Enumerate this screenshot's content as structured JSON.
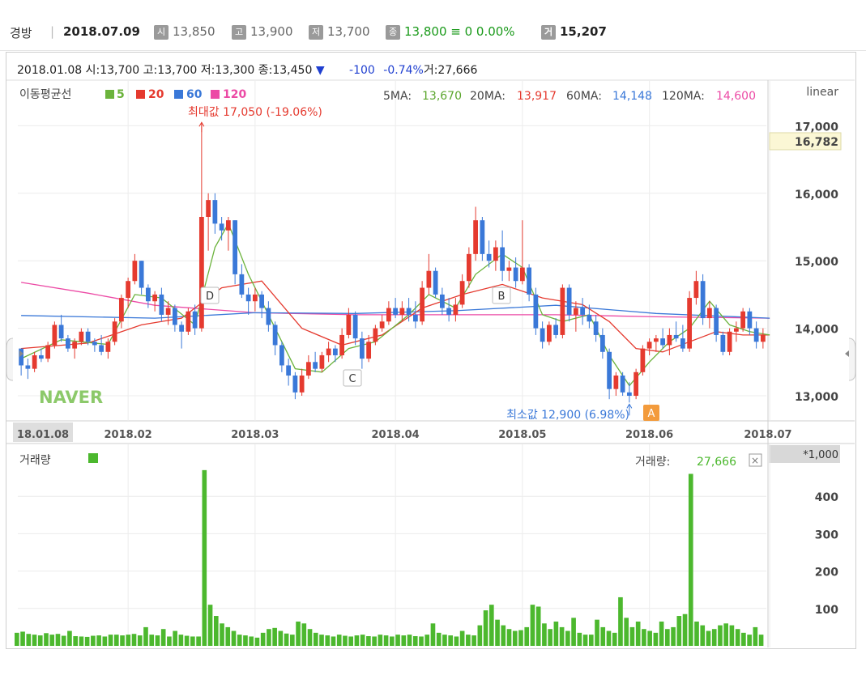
{
  "header": {
    "name": "경방",
    "separator": "|",
    "date": "2018.07.09",
    "open_icon": "시",
    "open": "13,850",
    "high_icon": "고",
    "high": "13,900",
    "low_icon": "저",
    "low": "13,700",
    "close_icon": "종",
    "close_change": "13,800 ≡ 0 0.00%",
    "volume_icon": "거",
    "volume": "15,207"
  },
  "info_bar": {
    "date": "2018.01.08",
    "open": "시:13,700",
    "high": "고:13,700",
    "low": "저:13,300",
    "close": "종:13,450",
    "down_icon": "▼",
    "change": "-100",
    "pct": "-0.74%",
    "volume": "거:27,666"
  },
  "ma_legend": {
    "title": "이동평균선",
    "items": [
      {
        "label": "5",
        "color": "#6bb33c"
      },
      {
        "label": "20",
        "color": "#e53a2f"
      },
      {
        "label": "60",
        "color": "#3a78d8"
      },
      {
        "label": "120",
        "color": "#ec4aa5"
      }
    ]
  },
  "ma_values": {
    "ma5_label": "5MA:",
    "ma5": "13,670",
    "ma20_label": "20MA:",
    "ma20": "13,917",
    "ma60_label": "60MA:",
    "ma60": "14,148",
    "ma120_label": "120MA:",
    "ma120": "14,600"
  },
  "scale_label": "linear",
  "current_price_tag": "16,782",
  "max_annotation": "최대값 17,050 (-19.06%)",
  "min_annotation": "최소값 12,900 (6.98%)",
  "watermark": "NAVER",
  "markers": [
    "A",
    "B",
    "C",
    "D"
  ],
  "volume_panel": {
    "label": "거래량",
    "value_label": "거래량:",
    "value": "27,666",
    "close_icon": "×",
    "unit": "*1,000"
  },
  "colors": {
    "up": "#e53a2f",
    "down": "#3a78d8",
    "volume": "#4cb82e",
    "ma5": "#6bb33c",
    "ma20": "#e53a2f",
    "ma60": "#3a78d8",
    "ma120": "#ec4aa5"
  },
  "chart_data": [
    {
      "type": "candlestick",
      "x_ticks": [
        "18.01.08",
        "2018.02",
        "2018.03",
        "2018.04",
        "2018.05",
        "2018.06",
        "2018.07"
      ],
      "y_ticks": [
        13000,
        14000,
        15000,
        16000,
        17000
      ],
      "ylim": [
        12650,
        17250
      ],
      "scale": "linear",
      "max": {
        "value": 17050,
        "label": "최대값 17,050 (-19.06%)"
      },
      "min": {
        "value": 12900,
        "label": "최소값 12,900 (6.98%)"
      },
      "candles": [
        [
          13700,
          13700,
          13300,
          13450
        ],
        [
          13450,
          13550,
          13250,
          13400
        ],
        [
          13400,
          13650,
          13350,
          13600
        ],
        [
          13600,
          13700,
          13500,
          13550
        ],
        [
          13550,
          13800,
          13500,
          13750
        ],
        [
          13750,
          14100,
          13700,
          14050
        ],
        [
          14050,
          14200,
          13800,
          13850
        ],
        [
          13850,
          13900,
          13650,
          13700
        ],
        [
          13700,
          13850,
          13550,
          13800
        ],
        [
          13800,
          14000,
          13750,
          13950
        ],
        [
          13950,
          14000,
          13750,
          13800
        ],
        [
          13800,
          13850,
          13650,
          13750
        ],
        [
          13750,
          13900,
          13600,
          13650
        ],
        [
          13650,
          13850,
          13550,
          13800
        ],
        [
          13800,
          14150,
          13750,
          14100
        ],
        [
          14100,
          14500,
          14000,
          14450
        ],
        [
          14450,
          14750,
          14300,
          14700
        ],
        [
          14700,
          15100,
          14650,
          15000
        ],
        [
          15000,
          15000,
          14500,
          14600
        ],
        [
          14600,
          14650,
          14300,
          14400
        ],
        [
          14400,
          14550,
          14250,
          14500
        ],
        [
          14500,
          14600,
          14100,
          14200
        ],
        [
          14200,
          14400,
          14050,
          14300
        ],
        [
          14300,
          14350,
          13950,
          14050
        ],
        [
          14050,
          14100,
          13700,
          13950
        ],
        [
          13950,
          14300,
          13900,
          14250
        ],
        [
          14250,
          14350,
          13900,
          14000
        ],
        [
          14000,
          17050,
          13950,
          15650
        ],
        [
          15650,
          16000,
          15150,
          15900
        ],
        [
          15900,
          16000,
          15400,
          15550
        ],
        [
          15550,
          15650,
          15300,
          15450
        ],
        [
          15450,
          15650,
          15150,
          15600
        ],
        [
          15600,
          15600,
          14650,
          14800
        ],
        [
          14800,
          14950,
          14450,
          14500
        ],
        [
          14500,
          14600,
          14200,
          14400
        ],
        [
          14400,
          14600,
          14250,
          14500
        ],
        [
          14500,
          14550,
          14150,
          14300
        ],
        [
          14300,
          14400,
          13950,
          14050
        ],
        [
          14050,
          14100,
          13600,
          13750
        ],
        [
          13750,
          13800,
          13350,
          13450
        ],
        [
          13450,
          13550,
          13150,
          13300
        ],
        [
          13300,
          13350,
          12950,
          13050
        ],
        [
          13050,
          13400,
          13000,
          13300
        ],
        [
          13300,
          13600,
          13250,
          13500
        ],
        [
          13500,
          13650,
          13350,
          13400
        ],
        [
          13400,
          13650,
          13350,
          13600
        ],
        [
          13600,
          13800,
          13500,
          13700
        ],
        [
          13700,
          13750,
          13500,
          13600
        ],
        [
          13600,
          14000,
          13550,
          13900
        ],
        [
          13900,
          14300,
          13850,
          14200
        ],
        [
          14200,
          14250,
          13750,
          13850
        ],
        [
          13850,
          13950,
          13400,
          13550
        ],
        [
          13550,
          13900,
          13500,
          13800
        ],
        [
          13800,
          14050,
          13750,
          14000
        ],
        [
          14000,
          14200,
          13950,
          14100
        ],
        [
          14100,
          14400,
          14050,
          14300
        ],
        [
          14300,
          14450,
          14150,
          14200
        ],
        [
          14200,
          14400,
          14100,
          14300
        ],
        [
          14300,
          14450,
          14100,
          14200
        ],
        [
          14200,
          14400,
          14000,
          14100
        ],
        [
          14100,
          14700,
          14050,
          14600
        ],
        [
          14600,
          15100,
          14500,
          14850
        ],
        [
          14850,
          14900,
          14450,
          14500
        ],
        [
          14500,
          14600,
          14200,
          14300
        ],
        [
          14300,
          14450,
          14100,
          14200
        ],
        [
          14200,
          14450,
          14100,
          14350
        ],
        [
          14350,
          14800,
          14300,
          14700
        ],
        [
          14700,
          15200,
          14600,
          15100
        ],
        [
          15100,
          15800,
          15000,
          15600
        ],
        [
          15600,
          15650,
          15000,
          15100
        ],
        [
          15100,
          15300,
          14900,
          15000
        ],
        [
          15000,
          15300,
          14850,
          15200
        ],
        [
          15200,
          15450,
          14700,
          14850
        ],
        [
          14850,
          15000,
          14700,
          14900
        ],
        [
          14900,
          15050,
          14600,
          14700
        ],
        [
          14700,
          15600,
          14650,
          14900
        ],
        [
          14900,
          14950,
          14400,
          14500
        ],
        [
          14500,
          14600,
          13900,
          14000
        ],
        [
          14000,
          14100,
          13700,
          13800
        ],
        [
          13800,
          14100,
          13750,
          14050
        ],
        [
          14050,
          14150,
          13850,
          13900
        ],
        [
          13900,
          14650,
          13850,
          14600
        ],
        [
          14600,
          14650,
          14100,
          14200
        ],
        [
          14200,
          14400,
          13950,
          14300
        ],
        [
          14300,
          14450,
          14050,
          14200
        ],
        [
          14200,
          14350,
          14000,
          14100
        ],
        [
          14100,
          14200,
          13800,
          13900
        ],
        [
          13900,
          14000,
          13550,
          13650
        ],
        [
          13650,
          13700,
          12950,
          13100
        ],
        [
          13100,
          13350,
          13000,
          13300
        ],
        [
          13300,
          13350,
          13000,
          13050
        ],
        [
          13050,
          13200,
          12900,
          13000
        ],
        [
          13000,
          13400,
          12950,
          13350
        ],
        [
          13350,
          13750,
          13300,
          13700
        ],
        [
          13700,
          13850,
          13600,
          13800
        ],
        [
          13800,
          13900,
          13650,
          13850
        ],
        [
          13850,
          14000,
          13700,
          13750
        ],
        [
          13750,
          14000,
          13600,
          13900
        ],
        [
          13900,
          14100,
          13800,
          13850
        ],
        [
          13850,
          14050,
          13650,
          13700
        ],
        [
          13700,
          14550,
          13650,
          14450
        ],
        [
          14450,
          14850,
          14350,
          14700
        ],
        [
          14700,
          14800,
          14050,
          14150
        ],
        [
          14150,
          14400,
          14000,
          14300
        ],
        [
          14300,
          14350,
          13800,
          13900
        ],
        [
          13900,
          13950,
          13600,
          13650
        ],
        [
          13650,
          14000,
          13600,
          13950
        ],
        [
          13950,
          14100,
          13800,
          14000
        ],
        [
          14000,
          14300,
          13950,
          14250
        ],
        [
          14250,
          14300,
          13900,
          14000
        ],
        [
          14000,
          14100,
          13700,
          13800
        ],
        [
          13800,
          14000,
          13700,
          13900
        ]
      ],
      "ma5": [
        [
          0,
          13550
        ],
        [
          6,
          13830
        ],
        [
          13,
          13760
        ],
        [
          17,
          14500
        ],
        [
          21,
          14450
        ],
        [
          26,
          14050
        ],
        [
          29,
          15200
        ],
        [
          31,
          15550
        ],
        [
          34,
          14800
        ],
        [
          37,
          14200
        ],
        [
          41,
          13400
        ],
        [
          45,
          13350
        ],
        [
          49,
          13700
        ],
        [
          53,
          13800
        ],
        [
          58,
          14200
        ],
        [
          61,
          14500
        ],
        [
          65,
          14300
        ],
        [
          68,
          14800
        ],
        [
          72,
          15100
        ],
        [
          75,
          14900
        ],
        [
          78,
          14200
        ],
        [
          81,
          14100
        ],
        [
          85,
          14200
        ],
        [
          88,
          13600
        ],
        [
          91,
          13150
        ],
        [
          94,
          13500
        ],
        [
          97,
          13800
        ],
        [
          100,
          14000
        ],
        [
          103,
          14400
        ],
        [
          106,
          14050
        ],
        [
          109,
          13950
        ],
        [
          112,
          13900
        ]
      ],
      "ma20": [
        [
          0,
          13700
        ],
        [
          10,
          13780
        ],
        [
          18,
          14050
        ],
        [
          24,
          14150
        ],
        [
          30,
          14600
        ],
        [
          36,
          14700
        ],
        [
          42,
          14000
        ],
        [
          48,
          13750
        ],
        [
          54,
          13900
        ],
        [
          60,
          14300
        ],
        [
          66,
          14500
        ],
        [
          72,
          14650
        ],
        [
          78,
          14450
        ],
        [
          84,
          14350
        ],
        [
          88,
          14100
        ],
        [
          92,
          13700
        ],
        [
          96,
          13650
        ],
        [
          100,
          13800
        ],
        [
          104,
          13950
        ],
        [
          108,
          13900
        ],
        [
          112,
          13900
        ]
      ],
      "ma60": [
        [
          0,
          14190
        ],
        [
          20,
          14150
        ],
        [
          35,
          14230
        ],
        [
          50,
          14220
        ],
        [
          65,
          14260
        ],
        [
          80,
          14340
        ],
        [
          95,
          14220
        ],
        [
          112,
          14150
        ]
      ],
      "ma120": [
        [
          0,
          14680
        ],
        [
          10,
          14520
        ],
        [
          20,
          14340
        ],
        [
          35,
          14230
        ],
        [
          50,
          14200
        ],
        [
          65,
          14200
        ],
        [
          80,
          14200
        ],
        [
          95,
          14170
        ],
        [
          112,
          14150
        ]
      ]
    },
    {
      "type": "bar",
      "title": "거래량",
      "unit": "*1,000",
      "y_ticks": [
        100,
        200,
        300,
        400
      ],
      "ylim": [
        0,
        500
      ],
      "values": [
        35,
        38,
        32,
        30,
        28,
        34,
        30,
        32,
        27,
        40,
        26,
        25,
        24,
        27,
        28,
        25,
        30,
        30,
        28,
        30,
        32,
        28,
        50,
        30,
        28,
        45,
        25,
        40,
        30,
        27,
        25,
        25,
        470,
        110,
        80,
        60,
        50,
        40,
        30,
        28,
        25,
        22,
        35,
        45,
        48,
        40,
        33,
        30,
        65,
        60,
        45,
        35,
        30,
        28,
        25,
        30,
        27,
        25,
        28,
        30,
        26,
        25,
        30,
        28,
        25,
        30,
        28,
        30,
        26,
        25,
        30,
        60,
        35,
        30,
        28,
        25,
        40,
        30,
        28,
        55,
        95,
        110,
        70,
        55,
        45,
        40,
        42,
        50,
        110,
        105,
        60,
        45,
        65,
        50,
        40,
        75,
        35,
        30,
        30,
        70,
        50,
        40,
        35,
        130,
        75,
        50,
        65,
        45,
        40,
        35,
        65,
        45,
        50,
        80,
        85,
        460,
        65,
        55,
        40,
        45,
        55,
        60,
        55,
        45,
        35,
        30,
        50,
        30
      ]
    }
  ]
}
